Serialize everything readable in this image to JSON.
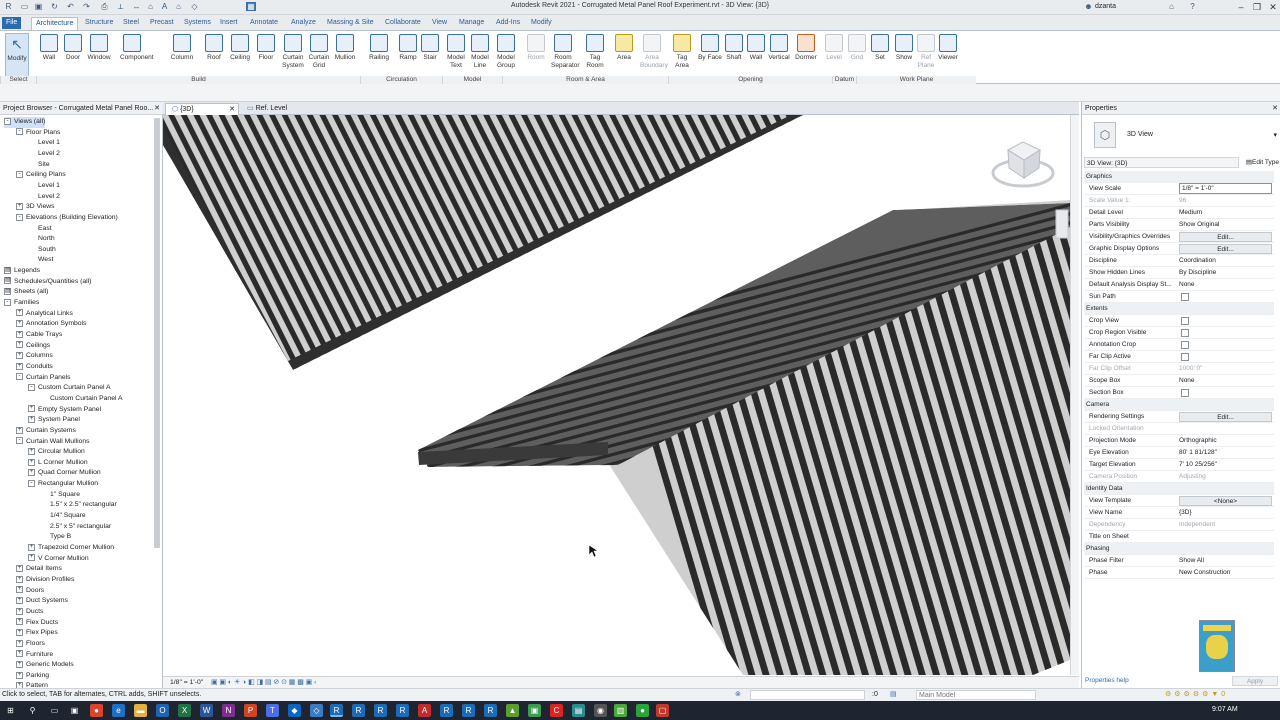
{
  "window": {
    "title": "Autodesk Revit 2021 - Corrugated Metal Panel Roof Experiment.rvt - 3D View: {3D}",
    "user": "dzanta"
  },
  "ribbon": {
    "tabs": [
      "File",
      "Architecture",
      "Structure",
      "Steel",
      "Precast",
      "Systems",
      "Insert",
      "Annotate",
      "Analyze",
      "Massing & Site",
      "Collaborate",
      "View",
      "Manage",
      "Add-Ins",
      "Modify"
    ],
    "active_tab": "Architecture",
    "tools": [
      {
        "label": "Modify",
        "icon": "modify-cursor-icon"
      },
      {
        "label": "Wall",
        "icon": "wall-icon"
      },
      {
        "label": "Door",
        "icon": "door-icon"
      },
      {
        "label": "Window",
        "icon": "window-icon"
      },
      {
        "label": "Component",
        "icon": "component-icon"
      },
      {
        "label": "Column",
        "icon": "column-icon"
      },
      {
        "label": "Roof",
        "icon": "roof-icon"
      },
      {
        "label": "Ceiling",
        "icon": "ceiling-icon"
      },
      {
        "label": "Floor",
        "icon": "floor-icon"
      },
      {
        "label": "Curtain System",
        "icon": "curtain-system-icon"
      },
      {
        "label": "Curtain Grid",
        "icon": "curtain-grid-icon"
      },
      {
        "label": "Mullion",
        "icon": "mullion-icon"
      },
      {
        "label": "Railing",
        "icon": "railing-icon"
      },
      {
        "label": "Ramp",
        "icon": "ramp-icon"
      },
      {
        "label": "Stair",
        "icon": "stair-icon"
      },
      {
        "label": "Model Text",
        "icon": "model-text-icon"
      },
      {
        "label": "Model Line",
        "icon": "model-line-icon"
      },
      {
        "label": "Model Group",
        "icon": "model-group-icon"
      },
      {
        "label": "Room",
        "icon": "room-icon"
      },
      {
        "label": "Room Separator",
        "icon": "room-separator-icon"
      },
      {
        "label": "Tag Room",
        "icon": "tag-room-icon"
      },
      {
        "label": "Area",
        "icon": "area-icon"
      },
      {
        "label": "Area Boundary",
        "icon": "area-boundary-icon"
      },
      {
        "label": "Tag Area",
        "icon": "tag-area-icon"
      },
      {
        "label": "By Face",
        "icon": "by-face-icon"
      },
      {
        "label": "Shaft",
        "icon": "shaft-icon"
      },
      {
        "label": "Wall",
        "icon": "wall-opening-icon"
      },
      {
        "label": "Vertical",
        "icon": "vertical-opening-icon"
      },
      {
        "label": "Dormer",
        "icon": "dormer-icon"
      },
      {
        "label": "Level",
        "icon": "level-icon"
      },
      {
        "label": "Grid",
        "icon": "grid-icon"
      },
      {
        "label": "Set",
        "icon": "set-workplane-icon"
      },
      {
        "label": "Show",
        "icon": "show-workplane-icon"
      },
      {
        "label": "Ref Plane",
        "icon": "ref-plane-icon"
      },
      {
        "label": "Viewer",
        "icon": "viewer-icon"
      }
    ],
    "panels": [
      "Select",
      "Build",
      "Circulation",
      "Model",
      "Room & Area",
      "Opening",
      "Datum",
      "Work Plane"
    ]
  },
  "project_browser": {
    "title": "Project Browser - Corrugated Metal Panel Roo...",
    "items": [
      {
        "label": "Views (all)",
        "depth": 0,
        "toggle": "-",
        "selected": true
      },
      {
        "label": "Floor Plans",
        "depth": 1,
        "toggle": "-"
      },
      {
        "label": "Level 1",
        "depth": 2,
        "toggle": ""
      },
      {
        "label": "Level 2",
        "depth": 2,
        "toggle": ""
      },
      {
        "label": "Site",
        "depth": 2,
        "toggle": ""
      },
      {
        "label": "Ceiling Plans",
        "depth": 1,
        "toggle": "-"
      },
      {
        "label": "Level 1",
        "depth": 2,
        "toggle": ""
      },
      {
        "label": "Level 2",
        "depth": 2,
        "toggle": ""
      },
      {
        "label": "3D Views",
        "depth": 1,
        "toggle": "+"
      },
      {
        "label": "Elevations (Building Elevation)",
        "depth": 1,
        "toggle": "-"
      },
      {
        "label": "East",
        "depth": 2,
        "toggle": ""
      },
      {
        "label": "North",
        "depth": 2,
        "toggle": ""
      },
      {
        "label": "South",
        "depth": 2,
        "toggle": ""
      },
      {
        "label": "West",
        "depth": 2,
        "toggle": ""
      },
      {
        "label": "Legends",
        "depth": 0,
        "toggle": "#"
      },
      {
        "label": "Schedules/Quantities (all)",
        "depth": 0,
        "toggle": "#"
      },
      {
        "label": "Sheets (all)",
        "depth": 0,
        "toggle": "#"
      },
      {
        "label": "Families",
        "depth": 0,
        "toggle": "-"
      },
      {
        "label": "Analytical Links",
        "depth": 1,
        "toggle": "+"
      },
      {
        "label": "Annotation Symbols",
        "depth": 1,
        "toggle": "+"
      },
      {
        "label": "Cable Trays",
        "depth": 1,
        "toggle": "+"
      },
      {
        "label": "Ceilings",
        "depth": 1,
        "toggle": "+"
      },
      {
        "label": "Columns",
        "depth": 1,
        "toggle": "+"
      },
      {
        "label": "Conduits",
        "depth": 1,
        "toggle": "+"
      },
      {
        "label": "Curtain Panels",
        "depth": 1,
        "toggle": "-"
      },
      {
        "label": "Custom Curtain Panel A",
        "depth": 2,
        "toggle": "-"
      },
      {
        "label": "Custom Curtain Panel A",
        "depth": 3,
        "toggle": ""
      },
      {
        "label": "Empty System Panel",
        "depth": 2,
        "toggle": "+"
      },
      {
        "label": "System Panel",
        "depth": 2,
        "toggle": "+"
      },
      {
        "label": "Curtain Systems",
        "depth": 1,
        "toggle": "+"
      },
      {
        "label": "Curtain Wall Mullions",
        "depth": 1,
        "toggle": "-"
      },
      {
        "label": "Circular Mullion",
        "depth": 2,
        "toggle": "+"
      },
      {
        "label": "L Corner Mullion",
        "depth": 2,
        "toggle": "+"
      },
      {
        "label": "Quad Corner Mullion",
        "depth": 2,
        "toggle": "+"
      },
      {
        "label": "Rectangular Mullion",
        "depth": 2,
        "toggle": "-"
      },
      {
        "label": "1\" Square",
        "depth": 3,
        "toggle": ""
      },
      {
        "label": "1.5\" x 2.5\" rectangular",
        "depth": 3,
        "toggle": ""
      },
      {
        "label": "1/4\" Square",
        "depth": 3,
        "toggle": ""
      },
      {
        "label": "2.5\" x 5\" rectangular",
        "depth": 3,
        "toggle": ""
      },
      {
        "label": "Type B",
        "depth": 3,
        "toggle": ""
      },
      {
        "label": "Trapezoid Corner Mullion",
        "depth": 2,
        "toggle": "+"
      },
      {
        "label": "V Corner Mullion",
        "depth": 2,
        "toggle": "+"
      },
      {
        "label": "Detail Items",
        "depth": 1,
        "toggle": "+"
      },
      {
        "label": "Division Profiles",
        "depth": 1,
        "toggle": "+"
      },
      {
        "label": "Doors",
        "depth": 1,
        "toggle": "+"
      },
      {
        "label": "Duct Systems",
        "depth": 1,
        "toggle": "+"
      },
      {
        "label": "Ducts",
        "depth": 1,
        "toggle": "+"
      },
      {
        "label": "Flex Ducts",
        "depth": 1,
        "toggle": "+"
      },
      {
        "label": "Flex Pipes",
        "depth": 1,
        "toggle": "+"
      },
      {
        "label": "Floors",
        "depth": 1,
        "toggle": "+"
      },
      {
        "label": "Furniture",
        "depth": 1,
        "toggle": "+"
      },
      {
        "label": "Generic Models",
        "depth": 1,
        "toggle": "+"
      },
      {
        "label": "Parking",
        "depth": 1,
        "toggle": "+"
      },
      {
        "label": "Pattern",
        "depth": 1,
        "toggle": "+"
      }
    ]
  },
  "view_tabs": [
    {
      "label": "{3D}",
      "active": true
    },
    {
      "label": "Ref. Level",
      "active": false
    }
  ],
  "view_control": {
    "scale": "1/8\" = 1'-0\""
  },
  "properties": {
    "title": "Properties",
    "type_name": "3D View",
    "selector": "3D View: {3D}",
    "edit_type": "Edit Type",
    "rows": [
      {
        "group": "Graphics"
      },
      {
        "k": "View Scale",
        "v": "1/8\" = 1'-0\"",
        "style": "boxed"
      },
      {
        "k": "Scale Value    1:",
        "v": "96",
        "dim": true
      },
      {
        "k": "Detail Level",
        "v": "Medium"
      },
      {
        "k": "Parts Visibility",
        "v": "Show Original"
      },
      {
        "k": "Visibility/Graphics Overrides",
        "v": "Edit...",
        "style": "btn"
      },
      {
        "k": "Graphic Display Options",
        "v": "Edit...",
        "style": "btn"
      },
      {
        "k": "Discipline",
        "v": "Coordination"
      },
      {
        "k": "Show Hidden Lines",
        "v": "By Discipline"
      },
      {
        "k": "Default Analysis Display St...",
        "v": "None"
      },
      {
        "k": "Sun Path",
        "check": true
      },
      {
        "group": "Extents"
      },
      {
        "k": "Crop View",
        "check": true
      },
      {
        "k": "Crop Region Visible",
        "check": true
      },
      {
        "k": "Annotation Crop",
        "check": true
      },
      {
        "k": "Far Clip Active",
        "check": true
      },
      {
        "k": "Far Clip Offset",
        "v": "1000'  0\"",
        "dim": true
      },
      {
        "k": "Scope Box",
        "v": "None"
      },
      {
        "k": "Section Box",
        "check": true
      },
      {
        "group": "Camera"
      },
      {
        "k": "Rendering Settings",
        "v": "Edit...",
        "style": "btn"
      },
      {
        "k": "Locked Orientation",
        "v": "",
        "dim": true
      },
      {
        "k": "Projection Mode",
        "v": "Orthographic"
      },
      {
        "k": "Eye Elevation",
        "v": "80'  1 81/128\""
      },
      {
        "k": "Target Elevation",
        "v": "7'  10 25/256\""
      },
      {
        "k": "Camera Position",
        "v": "Adjusting",
        "dim": true
      },
      {
        "group": "Identity Data"
      },
      {
        "k": "View Template",
        "v": "<None>",
        "style": "btn"
      },
      {
        "k": "View Name",
        "v": "{3D}"
      },
      {
        "k": "Dependency",
        "v": "Independent",
        "dim": true
      },
      {
        "k": "Title on Sheet",
        "v": ""
      },
      {
        "group": "Phasing"
      },
      {
        "k": "Phase Filter",
        "v": "Show All"
      },
      {
        "k": "Phase",
        "v": "New Construction"
      }
    ],
    "help_link": "Properties help",
    "apply": "Apply"
  },
  "status": {
    "message": "Click to select, TAB for alternates, CTRL adds, SHIFT unselects.",
    "model": "Main Model",
    "workset_value": ":0"
  },
  "taskbar": {
    "time": "9:07 AM"
  }
}
